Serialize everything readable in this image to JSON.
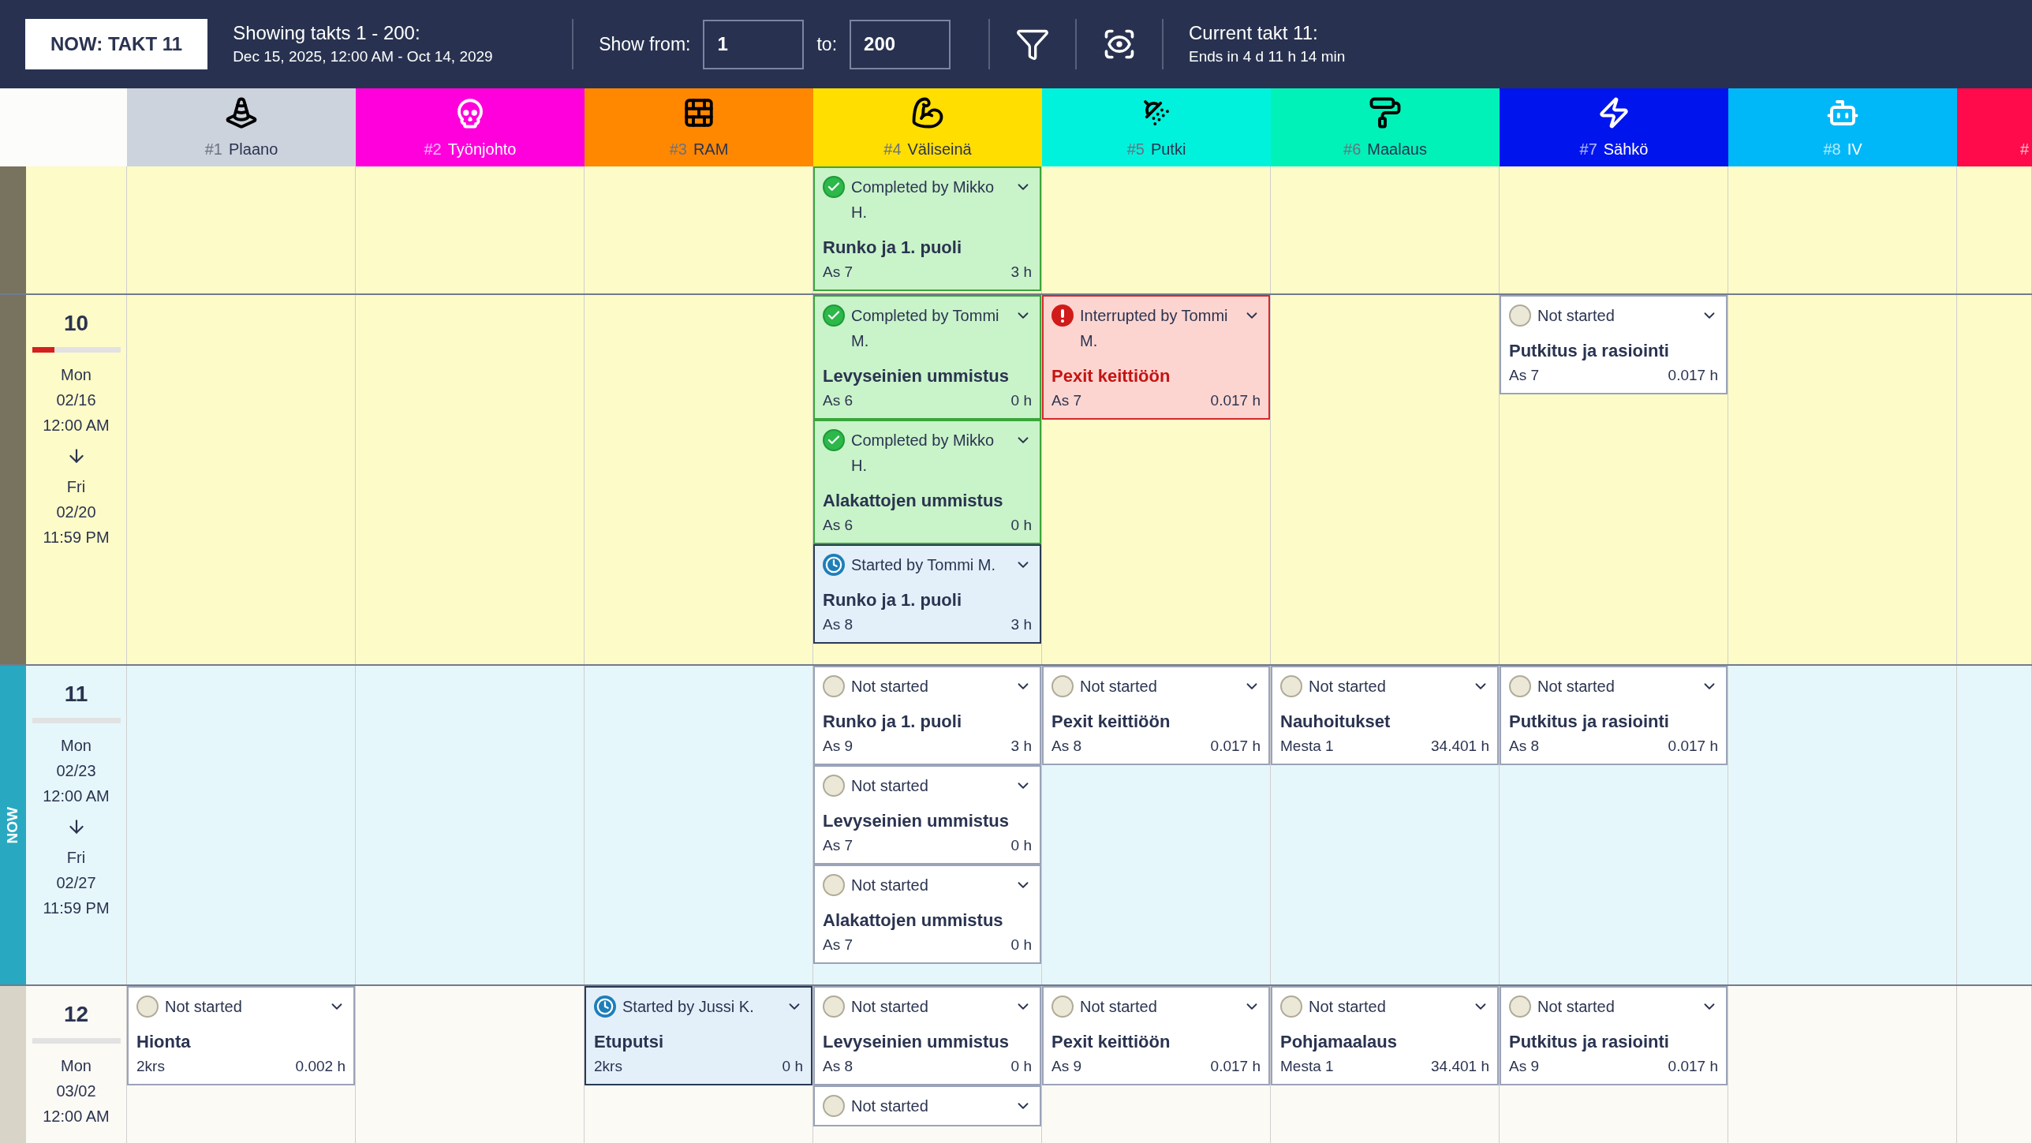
{
  "top_bar": {
    "now_button": "NOW: TAKT 11",
    "range_title": "Showing takts 1 - 200:",
    "range_dates": "Dec 15, 2025, 12:00 AM - Oct 14, 2029",
    "show_from_label": "Show from:",
    "show_from_value": "1",
    "to_label": "to:",
    "to_value": "200",
    "current_title": "Current takt 11:",
    "current_remaining": "Ends in 4 d 11 h 14 min"
  },
  "columns": [
    {
      "number": "#1",
      "name": "Plaano",
      "color": "#cdd3dd"
    },
    {
      "number": "#2",
      "name": "Työnjohto",
      "color": "#ff00dd"
    },
    {
      "number": "#3",
      "name": "RAM",
      "color": "#ff8800"
    },
    {
      "number": "#4",
      "name": "Väliseinä",
      "color": "#ffde00"
    },
    {
      "number": "#5",
      "name": "Putki",
      "color": "#00f2dc"
    },
    {
      "number": "#6",
      "name": "Maalaus",
      "color": "#00f2b8"
    },
    {
      "number": "#7",
      "name": "Sähkö",
      "color": "#0014ee"
    },
    {
      "number": "#8",
      "name": "IV",
      "color": "#00b8f8"
    },
    {
      "number": "#",
      "color": "#ff0a4a"
    }
  ],
  "rows": [
    {
      "kind": "past",
      "cells": [
        {},
        {},
        {},
        {
          "cards": [
            {
              "kind": "completed",
              "status": "Completed by Mikko H.",
              "title": "Runko ja 1. puoli",
              "location": "As 7",
              "hours": "3 h"
            }
          ]
        },
        {},
        {},
        {},
        {},
        {}
      ]
    },
    {
      "kind": "past",
      "takt": "10",
      "level": 0.25,
      "start_day": "Mon",
      "start_date": "02/16",
      "start_time": "12:00 AM",
      "end_day": "Fri",
      "end_date": "02/20",
      "end_time": "11:59 PM",
      "cells": [
        {},
        {},
        {},
        {
          "cards": [
            {
              "kind": "completed",
              "status": "Completed by Tommi M.",
              "title": "Levyseinien ummistus",
              "location": "As 6",
              "hours": "0 h"
            },
            {
              "kind": "completed",
              "status": "Completed by Mikko H.",
              "title": "Alakattojen ummistus",
              "location": "As 6",
              "hours": "0 h"
            },
            {
              "kind": "started",
              "status": "Started by Tommi M.",
              "title": "Runko ja 1. puoli",
              "location": "As 8",
              "hours": "3 h"
            }
          ]
        },
        {
          "cards": [
            {
              "kind": "interrupted",
              "status": "Interrupted by Tommi M.",
              "title": "Pexit keittiöön",
              "location": "As 7",
              "hours": "0.017 h"
            }
          ]
        },
        {},
        {
          "cards": [
            {
              "kind": "not_started",
              "status": "Not started",
              "title": "Putkitus ja rasiointi",
              "location": "As 7",
              "hours": "0.017 h"
            }
          ]
        },
        {},
        {}
      ]
    },
    {
      "kind": "current",
      "now_label": "NOW",
      "takt": "11",
      "start_day": "Mon",
      "start_date": "02/23",
      "start_time": "12:00 AM",
      "end_day": "Fri",
      "end_date": "02/27",
      "end_time": "11:59 PM",
      "cells": [
        {},
        {},
        {},
        {
          "cards": [
            {
              "kind": "not_started",
              "status": "Not started",
              "title": "Runko ja 1. puoli",
              "location": "As 9",
              "hours": "3 h"
            },
            {
              "kind": "not_started",
              "status": "Not started",
              "title": "Levyseinien ummistus",
              "location": "As 7",
              "hours": "0 h"
            },
            {
              "kind": "not_started",
              "status": "Not started",
              "title": "Alakattojen ummistus",
              "location": "As 7",
              "hours": "0 h"
            }
          ]
        },
        {
          "cards": [
            {
              "kind": "not_started",
              "status": "Not started",
              "title": "Pexit keittiöön",
              "location": "As 8",
              "hours": "0.017 h"
            }
          ]
        },
        {
          "cards": [
            {
              "kind": "not_started",
              "status": "Not started",
              "title": "Nauhoitukset",
              "location": "Mesta 1",
              "hours": "34.401 h"
            }
          ]
        },
        {
          "cards": [
            {
              "kind": "not_started",
              "status": "Not started",
              "title": "Putkitus ja rasiointi",
              "location": "As 8",
              "hours": "0.017 h"
            }
          ]
        },
        {},
        {}
      ]
    },
    {
      "kind": "future",
      "takt": "12",
      "start_day": "Mon",
      "start_date": "03/02",
      "start_time": "12:00 AM",
      "cells": [
        {
          "cards": [
            {
              "kind": "not_started",
              "status": "Not started",
              "title": "Hionta",
              "location": "2krs",
              "hours": "0.002 h"
            }
          ]
        },
        {},
        {
          "cards": [
            {
              "kind": "started",
              "status": "Started by Jussi K.",
              "title": "Etuputsi",
              "location": "2krs",
              "hours": "0 h"
            }
          ]
        },
        {
          "cards": [
            {
              "kind": "not_started",
              "status": "Not started",
              "title": "Levyseinien ummistus",
              "location": "As 8",
              "hours": "0 h"
            },
            {
              "kind": "not_started",
              "status": "Not started"
            }
          ]
        },
        {
          "cards": [
            {
              "kind": "not_started",
              "status": "Not started",
              "title": "Pexit keittiöön",
              "location": "As 9",
              "hours": "0.017 h"
            }
          ]
        },
        {
          "cards": [
            {
              "kind": "not_started",
              "status": "Not started",
              "title": "Pohjamaalaus",
              "location": "Mesta 1",
              "hours": "34.401 h"
            }
          ]
        },
        {
          "cards": [
            {
              "kind": "not_started",
              "status": "Not started",
              "title": "Putkitus ja rasiointi",
              "location": "As 9",
              "hours": "0.017 h"
            }
          ]
        },
        {},
        {}
      ]
    }
  ]
}
